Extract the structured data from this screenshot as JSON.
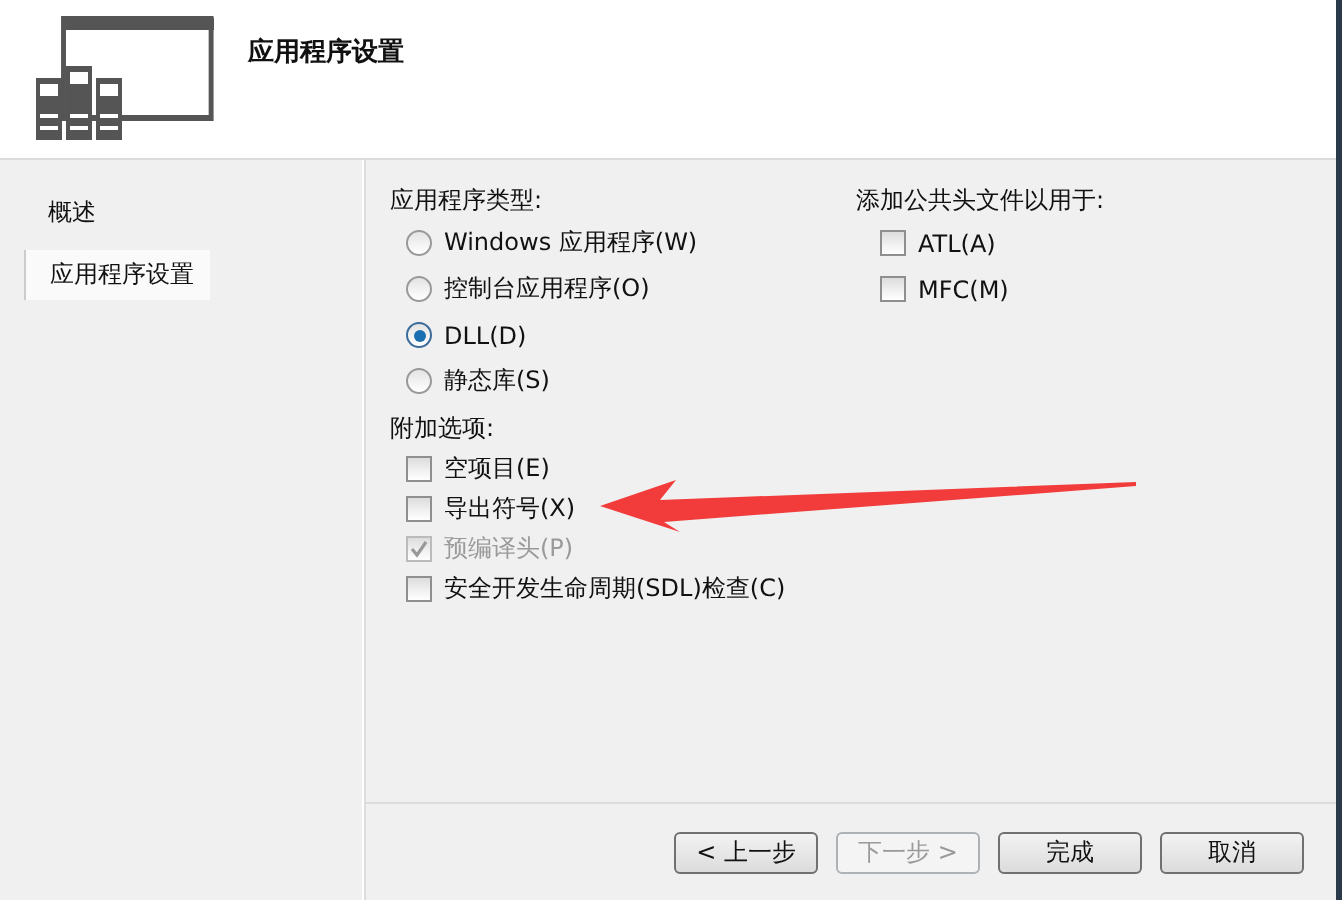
{
  "header": {
    "title": "应用程序设置"
  },
  "sidebar": {
    "items": [
      {
        "label": "概述",
        "selected": false
      },
      {
        "label": "应用程序设置",
        "selected": true
      }
    ]
  },
  "app_type": {
    "label": "应用程序类型:",
    "options": [
      {
        "label": "Windows 应用程序(W)",
        "selected": false
      },
      {
        "label": "控制台应用程序(O)",
        "selected": false
      },
      {
        "label": "DLL(D)",
        "selected": true
      },
      {
        "label": "静态库(S)",
        "selected": false
      }
    ]
  },
  "headers": {
    "label": "添加公共头文件以用于:",
    "options": [
      {
        "label": "ATL(A)",
        "checked": false
      },
      {
        "label": "MFC(M)",
        "checked": false
      }
    ]
  },
  "extra": {
    "label": "附加选项:",
    "options": [
      {
        "label": "空项目(E)",
        "checked": false,
        "disabled": false
      },
      {
        "label": "导出符号(X)",
        "checked": false,
        "disabled": false
      },
      {
        "label": "预编译头(P)",
        "checked": true,
        "disabled": true
      },
      {
        "label": "安全开发生命周期(SDL)检查(C)",
        "checked": false,
        "disabled": false
      }
    ]
  },
  "buttons": [
    {
      "label": "< 上一步",
      "disabled": false
    },
    {
      "label": "下一步 >",
      "disabled": true
    },
    {
      "label": "完成",
      "disabled": false
    },
    {
      "label": "取消",
      "disabled": false
    }
  ]
}
